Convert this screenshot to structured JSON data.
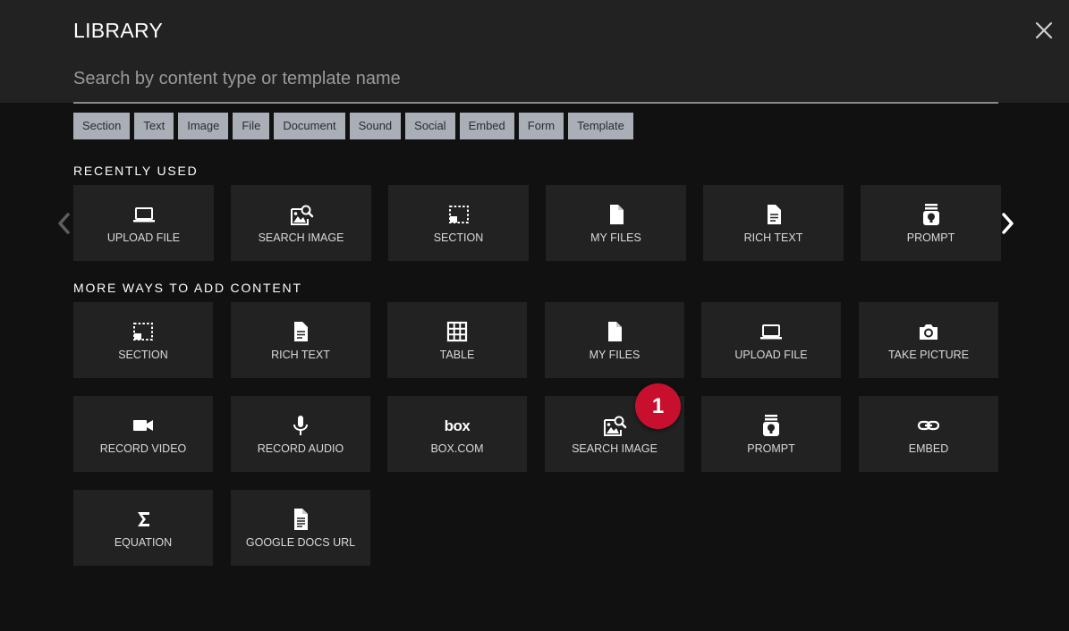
{
  "library": {
    "title": "LIBRARY",
    "close_icon": "close-icon",
    "search": {
      "placeholder": "Search by content type or template name",
      "value": ""
    },
    "filters": [
      "Section",
      "Text",
      "Image",
      "File",
      "Document",
      "Sound",
      "Social",
      "Embed",
      "Form",
      "Template"
    ],
    "recently_used": {
      "title": "RECENTLY USED",
      "items": [
        {
          "label": "UPLOAD FILE",
          "icon": "laptop-icon"
        },
        {
          "label": "SEARCH IMAGE",
          "icon": "image-search-icon"
        },
        {
          "label": "SECTION",
          "icon": "section-icon"
        },
        {
          "label": "MY FILES",
          "icon": "file-icon"
        },
        {
          "label": "RICH TEXT",
          "icon": "document-text-icon"
        },
        {
          "label": "PROMPT",
          "icon": "prompt-icon"
        }
      ]
    },
    "more_ways": {
      "title": "MORE WAYS TO ADD CONTENT",
      "items": [
        {
          "label": "SECTION",
          "icon": "section-icon"
        },
        {
          "label": "RICH TEXT",
          "icon": "document-text-icon"
        },
        {
          "label": "TABLE",
          "icon": "table-icon"
        },
        {
          "label": "MY FILES",
          "icon": "file-icon"
        },
        {
          "label": "UPLOAD FILE",
          "icon": "laptop-icon"
        },
        {
          "label": "TAKE PICTURE",
          "icon": "camera-icon"
        },
        {
          "label": "RECORD VIDEO",
          "icon": "video-camera-icon"
        },
        {
          "label": "RECORD AUDIO",
          "icon": "microphone-icon"
        },
        {
          "label": "BOX.COM",
          "icon": "box-logo-icon"
        },
        {
          "label": "SEARCH IMAGE",
          "icon": "image-search-icon"
        },
        {
          "label": "PROMPT",
          "icon": "prompt-icon"
        },
        {
          "label": "EMBED",
          "icon": "link-icon"
        },
        {
          "label": "EQUATION",
          "icon": "sigma-icon"
        },
        {
          "label": "GOOGLE DOCS URL",
          "icon": "google-doc-icon"
        }
      ]
    },
    "badge": "1",
    "colors": {
      "header": "#222222",
      "background": "#111111",
      "tile": "#222222",
      "chip": "#a9aeb7",
      "badge": "#c8102e"
    }
  }
}
